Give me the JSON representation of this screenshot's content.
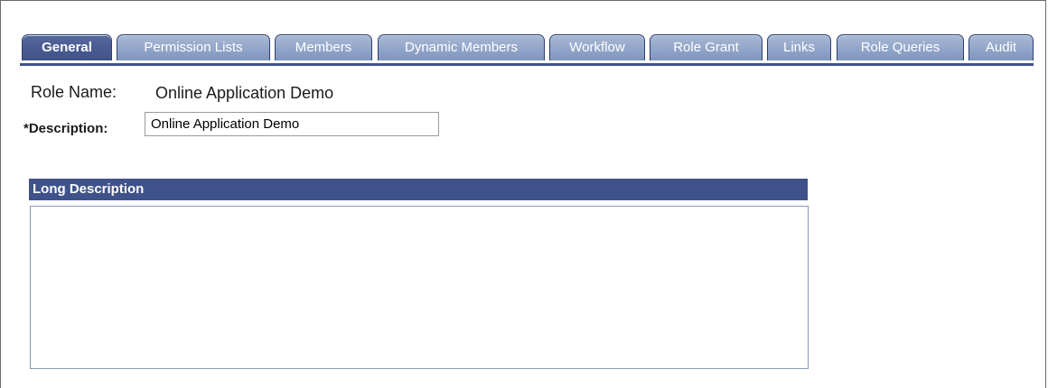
{
  "tabs": [
    {
      "label": "General",
      "active": true
    },
    {
      "label": "Permission Lists",
      "active": false
    },
    {
      "label": "Members",
      "active": false
    },
    {
      "label": "Dynamic Members",
      "active": false
    },
    {
      "label": "Workflow",
      "active": false
    },
    {
      "label": "Role Grant",
      "active": false
    },
    {
      "label": "Links",
      "active": false
    },
    {
      "label": "Role Queries",
      "active": false
    },
    {
      "label": "Audit",
      "active": false
    }
  ],
  "role_name": {
    "label": "Role Name:",
    "value": "Online Application Demo"
  },
  "description": {
    "label": "*Description:",
    "value": "Online Application Demo"
  },
  "long_description": {
    "header": "Long Description",
    "value": ""
  },
  "colors": {
    "accent": "#3f528a",
    "tab_inactive": "#8ea2c6"
  }
}
